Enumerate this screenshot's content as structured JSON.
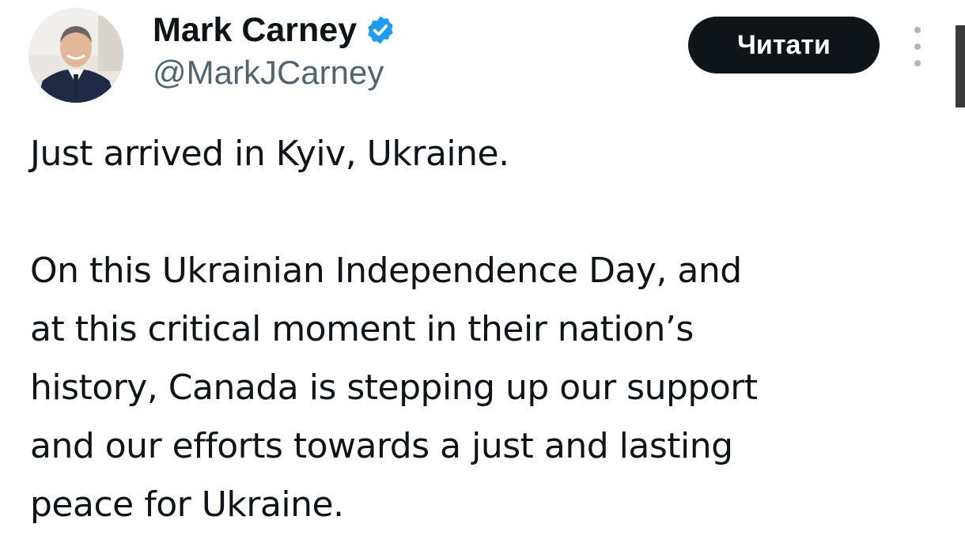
{
  "author": {
    "display_name": "Mark Carney",
    "handle": "@MarkJCarney",
    "verified": true,
    "verified_icon": "verified-badge-icon",
    "verified_color": "#1d9bf0"
  },
  "actions": {
    "follow_label": "Читати",
    "more_icon": "more-vertical-icon"
  },
  "tweet": {
    "paragraph_1": "Just arrived in Kyiv, Ukraine.",
    "paragraph_2": "On this Ukrainian Independence Day, and\nat this critical moment in their nation’s\nhistory, Canada is stepping up our support\nand our efforts towards a just and lasting\npeace for Ukraine."
  },
  "colors": {
    "text": "#0f1419",
    "secondary_text": "#536471",
    "button_bg": "#0f1419",
    "button_text": "#ffffff"
  }
}
